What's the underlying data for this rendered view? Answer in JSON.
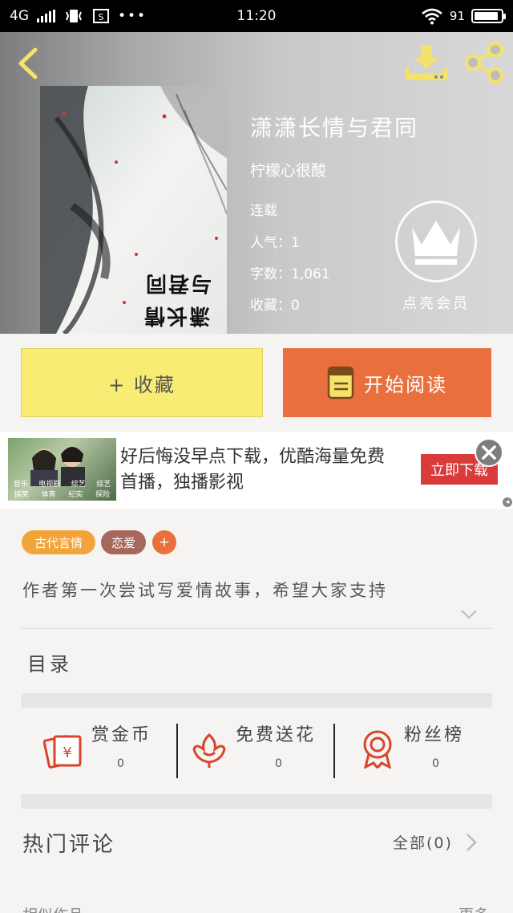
{
  "status_bar": {
    "network": "4G",
    "time": "11:20",
    "battery_text": "91",
    "battery_level": 0.91
  },
  "book": {
    "title": "潇潇长情与君同",
    "author": "柠檬心很酸",
    "status": "连载",
    "popularity_label": "人气：",
    "popularity_value": "1",
    "wordcount_label": "字数：",
    "wordcount_value": "1,061",
    "favorites_label": "收藏：",
    "favorites_value": "0",
    "cover_text_line1": "与君同",
    "cover_text_line2": "潇长情"
  },
  "vip": {
    "label": "点亮会员"
  },
  "actions": {
    "collect_label": "+ 收藏",
    "read_label": "开始阅读"
  },
  "ad": {
    "text": "好后悔没早点下载，优酷海量免费首播，独播影视",
    "cta": "立即下载",
    "thumb_row1": [
      "音乐",
      "电视剧",
      "综艺",
      "综艺"
    ],
    "thumb_row2": [
      "搞笑",
      "体育",
      "纪实",
      "探险"
    ]
  },
  "tags": [
    "古代言情",
    "恋爱",
    "+"
  ],
  "intro": "作者第一次尝试写爱情故事，希望大家支持",
  "toc_label": "目录",
  "stats": [
    {
      "label": "赏金币",
      "value": "0",
      "icon": "red-envelope-icon"
    },
    {
      "label": "免费送花",
      "value": "0",
      "icon": "flower-icon"
    },
    {
      "label": "粉丝榜",
      "value": "0",
      "icon": "medal-icon"
    }
  ],
  "comments": {
    "title": "热门评论",
    "all_label": "全部(0)"
  },
  "bottom": {
    "left": "相似作品",
    "right": "更多"
  },
  "colors": {
    "collect_bg": "#f8ec74",
    "read_bg": "#e9703c",
    "tag1": "#f2a43a",
    "tag2": "#a7685b",
    "tag3": "#e9703c",
    "accent_icon": "#f4e36b",
    "stat_icon": "#d9442b"
  }
}
